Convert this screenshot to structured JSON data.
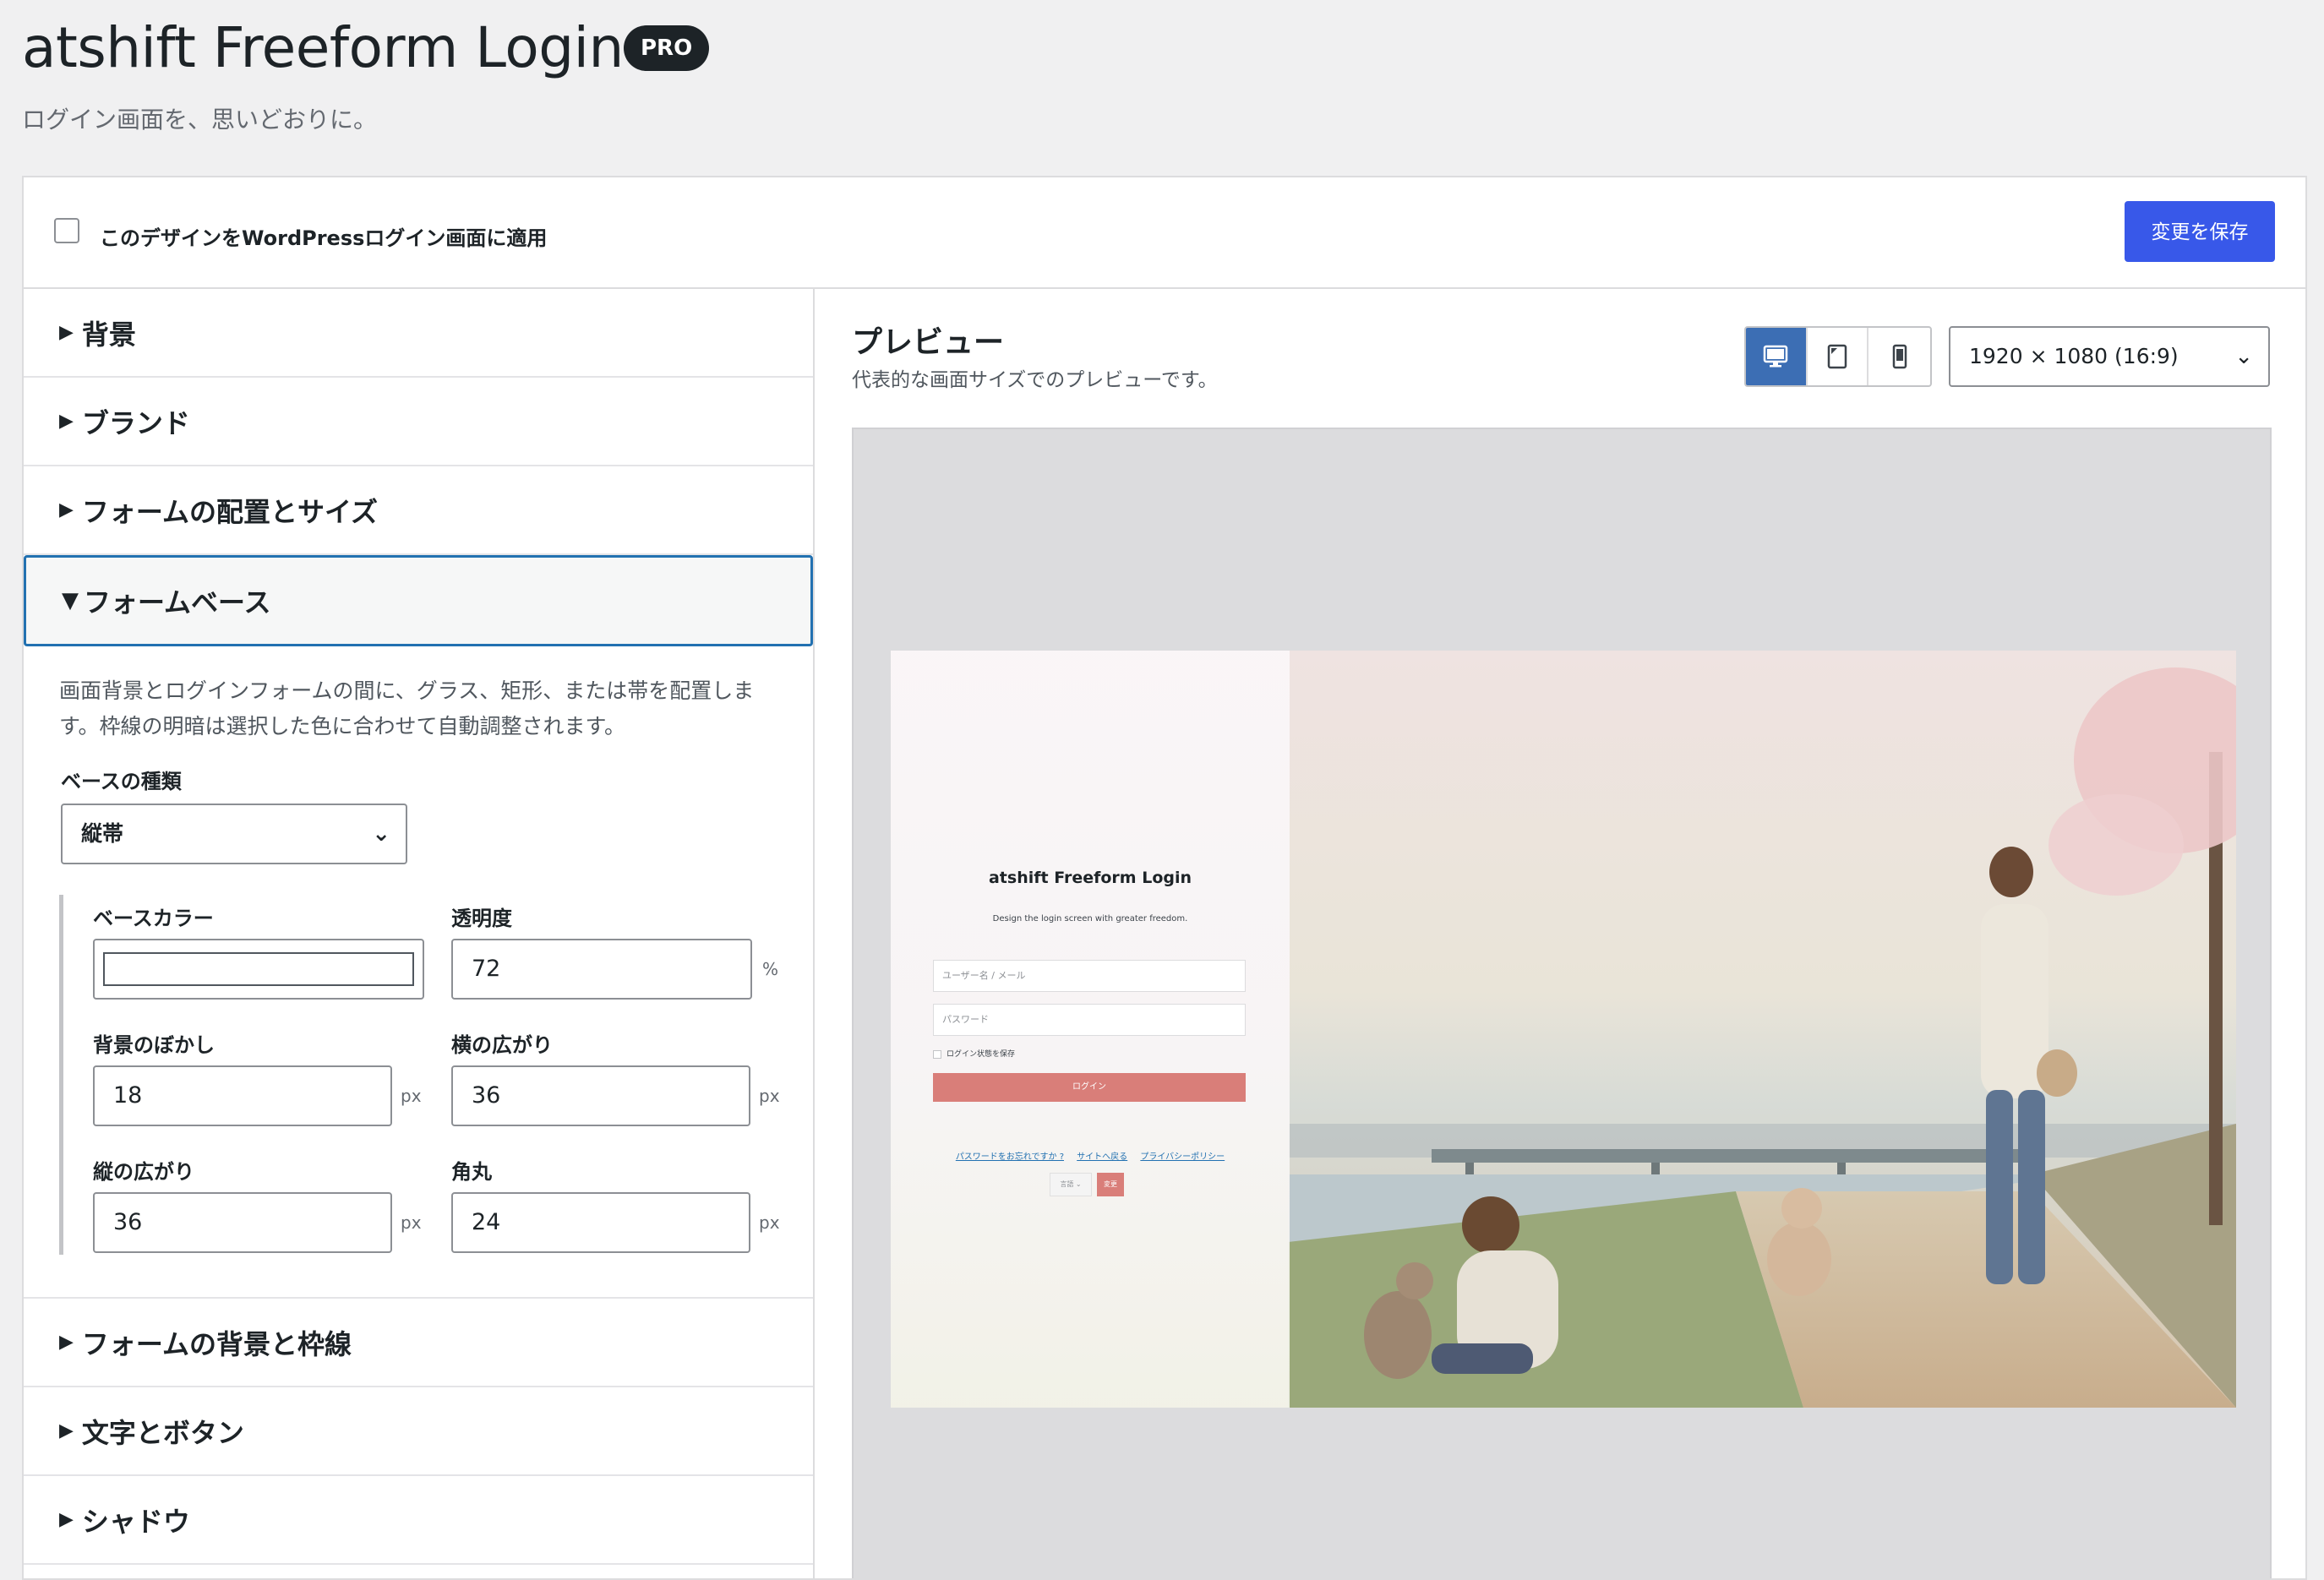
{
  "header": {
    "title": "atshift Freeform Login",
    "badge": "PRO",
    "subtitle": "ログイン画面を、思いどおりに。"
  },
  "topbar": {
    "apply_label": "このデザインをWordPressログイン画面に適用",
    "apply_checked": false,
    "save_label": "変更を保存"
  },
  "sections": {
    "background": "背景",
    "brand": "ブランド",
    "form_layout": "フォームの配置とサイズ",
    "form_base": "フォームベース",
    "form_bg_border": "フォームの背景と枠線",
    "text_buttons": "文字とボタン",
    "shadow": "シャドウ"
  },
  "form_base": {
    "description": "画面背景とログインフォームの間に、グラス、矩形、または帯を配置します。枠線の明暗は選択した色に合わせて自動調整されます。",
    "base_type_label": "ベースの種類",
    "base_type_value": "縦帯",
    "base_color_label": "ベースカラー",
    "base_color_value": "#ffffff",
    "opacity_label": "透明度",
    "opacity_value": "72",
    "opacity_unit": "%",
    "blur_label": "背景のぼかし",
    "blur_value": "18",
    "blur_unit": "px",
    "h_spread_label": "横の広がり",
    "h_spread_value": "36",
    "h_spread_unit": "px",
    "v_spread_label": "縦の広がり",
    "v_spread_value": "36",
    "v_spread_unit": "px",
    "radius_label": "角丸",
    "radius_value": "24",
    "radius_unit": "px"
  },
  "preview": {
    "title": "プレビュー",
    "description": "代表的な画面サイズでのプレビューです。",
    "devices": [
      "desktop-icon",
      "tablet-icon",
      "mobile-icon"
    ],
    "active_device": "desktop",
    "size_value": "1920 × 1080 (16:9)"
  },
  "login_form": {
    "title": "atshift Freeform Login",
    "subtitle": "Design the login screen with greater freedom.",
    "username_placeholder": "ユーザー名 / メール",
    "password_placeholder": "パスワード",
    "remember_label": "ログイン状態を保存",
    "login_button": "ログイン",
    "link_lost_password": "パスワードをお忘れですか ?",
    "link_back": "サイトへ戻る",
    "link_privacy": "プライバシーポリシー",
    "language_label": "言語",
    "change_button": "変更"
  },
  "colors": {
    "accent": "#3858e9",
    "login_button": "#d97e79",
    "active_device": "#3c6eb4"
  }
}
